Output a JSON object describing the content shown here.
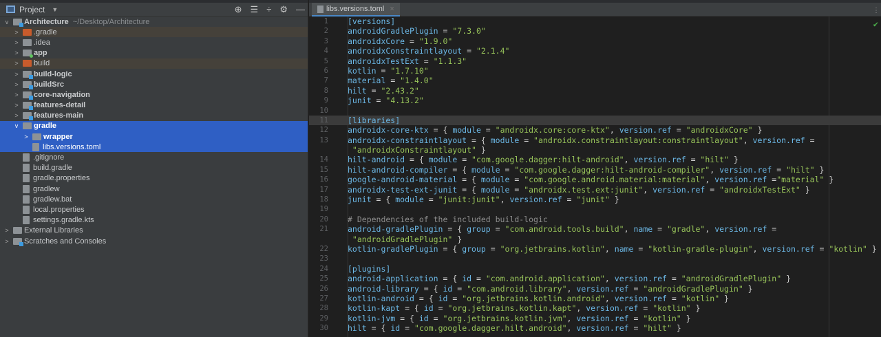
{
  "project_panel": {
    "title": "Project",
    "root": {
      "name": "Architecture",
      "path": "~/Desktop/Architecture"
    },
    "items": [
      {
        "label": ".gradle",
        "depth": 1,
        "kind": "folder-excluded",
        "arrow": ">"
      },
      {
        "label": ".idea",
        "depth": 1,
        "kind": "folder",
        "arrow": ">"
      },
      {
        "label": "app",
        "depth": 1,
        "kind": "module-app",
        "arrow": ">",
        "bold": true
      },
      {
        "label": "build",
        "depth": 1,
        "kind": "folder-excluded",
        "arrow": ">"
      },
      {
        "label": "build-logic",
        "depth": 1,
        "kind": "module",
        "arrow": ">",
        "bold": true
      },
      {
        "label": "buildSrc",
        "depth": 1,
        "kind": "module",
        "arrow": ">",
        "bold": true
      },
      {
        "label": "core-navigation",
        "depth": 1,
        "kind": "module",
        "arrow": ">",
        "bold": true
      },
      {
        "label": "features-detail",
        "depth": 1,
        "kind": "module",
        "arrow": ">",
        "bold": true
      },
      {
        "label": "features-main",
        "depth": 1,
        "kind": "module",
        "arrow": ">",
        "bold": true
      },
      {
        "label": "gradle",
        "depth": 1,
        "kind": "folder",
        "arrow": "v",
        "bold": true,
        "sel": true
      },
      {
        "label": "wrapper",
        "depth": 2,
        "kind": "folder",
        "arrow": ">",
        "bold": true,
        "sel": true
      },
      {
        "label": "libs.versions.toml",
        "depth": 2,
        "kind": "file",
        "arrow": "",
        "sel": true
      },
      {
        "label": ".gitignore",
        "depth": 1,
        "kind": "file",
        "arrow": ""
      },
      {
        "label": "build.gradle",
        "depth": 1,
        "kind": "file",
        "arrow": ""
      },
      {
        "label": "gradle.properties",
        "depth": 1,
        "kind": "file",
        "arrow": ""
      },
      {
        "label": "gradlew",
        "depth": 1,
        "kind": "file",
        "arrow": ""
      },
      {
        "label": "gradlew.bat",
        "depth": 1,
        "kind": "file",
        "arrow": ""
      },
      {
        "label": "local.properties",
        "depth": 1,
        "kind": "file",
        "arrow": ""
      },
      {
        "label": "settings.gradle.kts",
        "depth": 1,
        "kind": "file",
        "arrow": ""
      },
      {
        "label": "External Libraries",
        "depth": 0,
        "kind": "libs",
        "arrow": ">"
      },
      {
        "label": "Scratches and Consoles",
        "depth": 0,
        "kind": "scratch",
        "arrow": ">"
      }
    ]
  },
  "editor": {
    "tab": "libs.versions.toml",
    "current_line": "11",
    "lines": [
      {
        "n": "1",
        "t": [
          [
            "h",
            "[versions]"
          ]
        ]
      },
      {
        "n": "2",
        "t": [
          [
            "k",
            "androidGradlePlugin"
          ],
          [
            "p",
            " = "
          ],
          [
            "s",
            "\"7.3.0\""
          ]
        ]
      },
      {
        "n": "3",
        "t": [
          [
            "k",
            "androidxCore"
          ],
          [
            "p",
            " = "
          ],
          [
            "s",
            "\"1.9.0\""
          ]
        ]
      },
      {
        "n": "4",
        "t": [
          [
            "k",
            "androidxConstraintlayout"
          ],
          [
            "p",
            " = "
          ],
          [
            "s",
            "\"2.1.4\""
          ]
        ]
      },
      {
        "n": "5",
        "t": [
          [
            "k",
            "androidxTestExt"
          ],
          [
            "p",
            " = "
          ],
          [
            "s",
            "\"1.1.3\""
          ]
        ]
      },
      {
        "n": "6",
        "t": [
          [
            "k",
            "kotlin"
          ],
          [
            "p",
            " = "
          ],
          [
            "s",
            "\"1.7.10\""
          ]
        ]
      },
      {
        "n": "7",
        "t": [
          [
            "k",
            "material"
          ],
          [
            "p",
            " = "
          ],
          [
            "s",
            "\"1.4.0\""
          ]
        ]
      },
      {
        "n": "8",
        "t": [
          [
            "k",
            "hilt"
          ],
          [
            "p",
            " = "
          ],
          [
            "s",
            "\"2.43.2\""
          ]
        ]
      },
      {
        "n": "9",
        "t": [
          [
            "k",
            "junit"
          ],
          [
            "p",
            " = "
          ],
          [
            "s",
            "\"4.13.2\""
          ]
        ]
      },
      {
        "n": "10",
        "t": []
      },
      {
        "n": "11",
        "t": [
          [
            "h",
            "[libraries]"
          ]
        ]
      },
      {
        "n": "12",
        "t": [
          [
            "k",
            "androidx-core-ktx"
          ],
          [
            "p",
            " = { "
          ],
          [
            "k",
            "module"
          ],
          [
            "p",
            " = "
          ],
          [
            "s",
            "\"androidx.core:core-ktx\""
          ],
          [
            "p",
            ", "
          ],
          [
            "k",
            "version.ref"
          ],
          [
            "p",
            " = "
          ],
          [
            "s",
            "\"androidxCore\""
          ],
          [
            "p",
            " }"
          ]
        ]
      },
      {
        "n": "13",
        "t": [
          [
            "k",
            "androidx-constraintlayout"
          ],
          [
            "p",
            " = { "
          ],
          [
            "k",
            "module"
          ],
          [
            "p",
            " = "
          ],
          [
            "s",
            "\"androidx.constraintlayout:constraintlayout\""
          ],
          [
            "p",
            ", "
          ],
          [
            "k",
            "version.ref"
          ],
          [
            "p",
            " ="
          ]
        ]
      },
      {
        "n": "",
        "t": [
          [
            "s",
            " \"androidxConstraintlayout\""
          ],
          [
            "p",
            " }"
          ]
        ]
      },
      {
        "n": "14",
        "t": [
          [
            "k",
            "hilt-android"
          ],
          [
            "p",
            " = { "
          ],
          [
            "k",
            "module"
          ],
          [
            "p",
            " = "
          ],
          [
            "s",
            "\"com.google.dagger:hilt-android\""
          ],
          [
            "p",
            ", "
          ],
          [
            "k",
            "version.ref"
          ],
          [
            "p",
            " = "
          ],
          [
            "s",
            "\"hilt\""
          ],
          [
            "p",
            " }"
          ]
        ]
      },
      {
        "n": "15",
        "t": [
          [
            "k",
            "hilt-android-compiler"
          ],
          [
            "p",
            " = { "
          ],
          [
            "k",
            "module"
          ],
          [
            "p",
            " = "
          ],
          [
            "s",
            "\"com.google.dagger:hilt-android-compiler\""
          ],
          [
            "p",
            ", "
          ],
          [
            "k",
            "version.ref"
          ],
          [
            "p",
            " = "
          ],
          [
            "s",
            "\"hilt\""
          ],
          [
            "p",
            " }"
          ]
        ]
      },
      {
        "n": "16",
        "t": [
          [
            "k",
            "google-android-material"
          ],
          [
            "p",
            " = { "
          ],
          [
            "k",
            "module"
          ],
          [
            "p",
            " = "
          ],
          [
            "s",
            "\"com.google.android.material:material\""
          ],
          [
            "p",
            ", "
          ],
          [
            "k",
            "version.ref"
          ],
          [
            "p",
            " ="
          ],
          [
            "s",
            "\"material\""
          ],
          [
            "p",
            " }"
          ]
        ]
      },
      {
        "n": "17",
        "t": [
          [
            "k",
            "androidx-test-ext-junit"
          ],
          [
            "p",
            " = { "
          ],
          [
            "k",
            "module"
          ],
          [
            "p",
            " = "
          ],
          [
            "s",
            "\"androidx.test.ext:junit\""
          ],
          [
            "p",
            ", "
          ],
          [
            "k",
            "version.ref"
          ],
          [
            "p",
            " = "
          ],
          [
            "s",
            "\"androidxTestExt\""
          ],
          [
            "p",
            " }"
          ]
        ]
      },
      {
        "n": "18",
        "t": [
          [
            "k",
            "junit"
          ],
          [
            "p",
            " = { "
          ],
          [
            "k",
            "module"
          ],
          [
            "p",
            " = "
          ],
          [
            "s",
            "\"junit:junit\""
          ],
          [
            "p",
            ", "
          ],
          [
            "k",
            "version.ref"
          ],
          [
            "p",
            " = "
          ],
          [
            "s",
            "\"junit\""
          ],
          [
            "p",
            " }"
          ]
        ]
      },
      {
        "n": "19",
        "t": []
      },
      {
        "n": "20",
        "t": [
          [
            "c",
            "# Dependencies of the included build-logic"
          ]
        ]
      },
      {
        "n": "21",
        "t": [
          [
            "k",
            "android-gradlePlugin"
          ],
          [
            "p",
            " = { "
          ],
          [
            "k",
            "group"
          ],
          [
            "p",
            " = "
          ],
          [
            "s",
            "\"com.android.tools.build\""
          ],
          [
            "p",
            ", "
          ],
          [
            "k",
            "name"
          ],
          [
            "p",
            " = "
          ],
          [
            "s",
            "\"gradle\""
          ],
          [
            "p",
            ", "
          ],
          [
            "k",
            "version.ref"
          ],
          [
            "p",
            " ="
          ]
        ]
      },
      {
        "n": "",
        "t": [
          [
            "s",
            " \"androidGradlePlugin\""
          ],
          [
            "p",
            " }"
          ]
        ]
      },
      {
        "n": "22",
        "t": [
          [
            "k",
            "kotlin-gradlePlugin"
          ],
          [
            "p",
            " = { "
          ],
          [
            "k",
            "group"
          ],
          [
            "p",
            " = "
          ],
          [
            "s",
            "\"org.jetbrains.kotlin\""
          ],
          [
            "p",
            ", "
          ],
          [
            "k",
            "name"
          ],
          [
            "p",
            " = "
          ],
          [
            "s",
            "\"kotlin-gradle-plugin\""
          ],
          [
            "p",
            ", "
          ],
          [
            "k",
            "version.ref"
          ],
          [
            "p",
            " = "
          ],
          [
            "s",
            "\"kotlin\""
          ],
          [
            "p",
            " }"
          ]
        ]
      },
      {
        "n": "23",
        "t": []
      },
      {
        "n": "24",
        "t": [
          [
            "h",
            "[plugins]"
          ]
        ]
      },
      {
        "n": "25",
        "t": [
          [
            "k",
            "android-application"
          ],
          [
            "p",
            " = { "
          ],
          [
            "k",
            "id"
          ],
          [
            "p",
            " = "
          ],
          [
            "s",
            "\"com.android.application\""
          ],
          [
            "p",
            ", "
          ],
          [
            "k",
            "version.ref"
          ],
          [
            "p",
            " = "
          ],
          [
            "s",
            "\"androidGradlePlugin\""
          ],
          [
            "p",
            " }"
          ]
        ]
      },
      {
        "n": "26",
        "t": [
          [
            "k",
            "android-library"
          ],
          [
            "p",
            " = { "
          ],
          [
            "k",
            "id"
          ],
          [
            "p",
            " = "
          ],
          [
            "s",
            "\"com.android.library\""
          ],
          [
            "p",
            ", "
          ],
          [
            "k",
            "version.ref"
          ],
          [
            "p",
            " = "
          ],
          [
            "s",
            "\"androidGradlePlugin\""
          ],
          [
            "p",
            " }"
          ]
        ]
      },
      {
        "n": "27",
        "t": [
          [
            "k",
            "kotlin-android"
          ],
          [
            "p",
            " = { "
          ],
          [
            "k",
            "id"
          ],
          [
            "p",
            " = "
          ],
          [
            "s",
            "\"org.jetbrains.kotlin.android\""
          ],
          [
            "p",
            ", "
          ],
          [
            "k",
            "version.ref"
          ],
          [
            "p",
            " = "
          ],
          [
            "s",
            "\"kotlin\""
          ],
          [
            "p",
            " }"
          ]
        ]
      },
      {
        "n": "28",
        "t": [
          [
            "k",
            "kotlin-kapt"
          ],
          [
            "p",
            " = { "
          ],
          [
            "k",
            "id"
          ],
          [
            "p",
            " = "
          ],
          [
            "s",
            "\"org.jetbrains.kotlin.kapt\""
          ],
          [
            "p",
            ", "
          ],
          [
            "k",
            "version.ref"
          ],
          [
            "p",
            " = "
          ],
          [
            "s",
            "\"kotlin\""
          ],
          [
            "p",
            " }"
          ]
        ]
      },
      {
        "n": "29",
        "t": [
          [
            "k",
            "kotlin-jvm"
          ],
          [
            "p",
            " = { "
          ],
          [
            "k",
            "id"
          ],
          [
            "p",
            " = "
          ],
          [
            "s",
            "\"org.jetbrains.kotlin.jvm\""
          ],
          [
            "p",
            ", "
          ],
          [
            "k",
            "version.ref"
          ],
          [
            "p",
            " = "
          ],
          [
            "s",
            "\"kotlin\""
          ],
          [
            "p",
            " }"
          ]
        ]
      },
      {
        "n": "30",
        "t": [
          [
            "k",
            "hilt"
          ],
          [
            "p",
            " = { "
          ],
          [
            "k",
            "id"
          ],
          [
            "p",
            " = "
          ],
          [
            "s",
            "\"com.google.dagger.hilt.android\""
          ],
          [
            "p",
            ", "
          ],
          [
            "k",
            "version.ref"
          ],
          [
            "p",
            " = "
          ],
          [
            "s",
            "\"hilt\""
          ],
          [
            "p",
            " }"
          ]
        ]
      }
    ]
  }
}
